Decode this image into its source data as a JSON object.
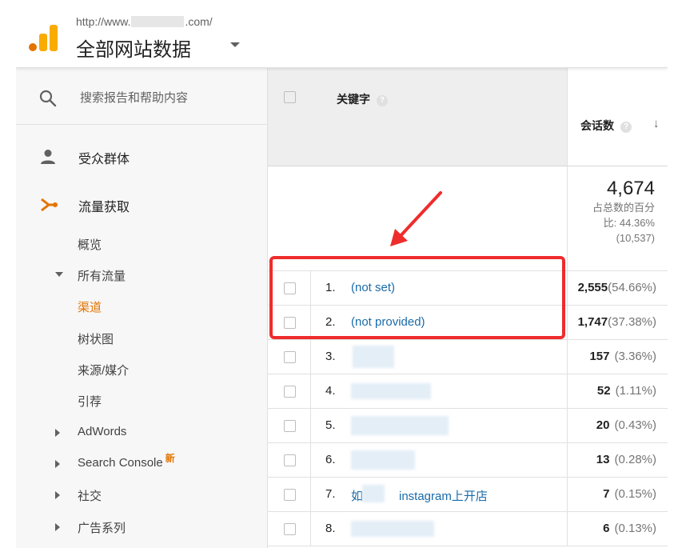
{
  "header": {
    "url_prefix": "http://www.",
    "url_suffix": ".com/",
    "property_title": "全部网站数据"
  },
  "sidebar": {
    "search_placeholder": "搜索报告和帮助内容",
    "main_items": [
      {
        "label": "受众群体",
        "icon": "person-icon"
      },
      {
        "label": "流量获取",
        "icon": "acquisition-icon"
      }
    ],
    "sub_items": [
      {
        "label": "概览"
      },
      {
        "label": "所有流量",
        "expanded": true
      },
      {
        "label": "渠道",
        "active": true
      },
      {
        "label": "树状图"
      },
      {
        "label": "来源/媒介"
      },
      {
        "label": "引荐"
      },
      {
        "label": "AdWords"
      },
      {
        "label": "Search Console",
        "badge": "新"
      },
      {
        "label": "社交"
      },
      {
        "label": "广告系列"
      }
    ],
    "accent_color": "#e37400"
  },
  "table": {
    "col_keyword": "关键字",
    "col_sessions": "会话数",
    "help_glyph": "?",
    "sort_glyph": "↓",
    "totals": {
      "value": "4,674",
      "pct_line1": "占总数的百分",
      "pct_line2": "比: 44.36%",
      "pct_line3": "(10,537)"
    },
    "rows": [
      {
        "idx": "1.",
        "keyword": "(not set)",
        "sessions": "2,555",
        "pct": "(54.66%)"
      },
      {
        "idx": "2.",
        "keyword": "(not provided)",
        "sessions": "1,747",
        "pct": "(37.38%)"
      },
      {
        "idx": "3.",
        "keyword": "",
        "sessions": "157",
        "pct": "(3.36%)"
      },
      {
        "idx": "4.",
        "keyword": "",
        "sessions": "52",
        "pct": "(1.11%)"
      },
      {
        "idx": "5.",
        "keyword": "",
        "sessions": "20",
        "pct": "(0.43%)"
      },
      {
        "idx": "6.",
        "keyword": "",
        "sessions": "13",
        "pct": "(0.28%)"
      },
      {
        "idx": "7.",
        "keyword": "如　　　instagram上开店",
        "sessions": "7",
        "pct": "(0.15%)"
      },
      {
        "idx": "8.",
        "keyword": "",
        "sessions": "6",
        "pct": "(0.13%)"
      }
    ]
  },
  "annotation_color": "#ef2c2c"
}
